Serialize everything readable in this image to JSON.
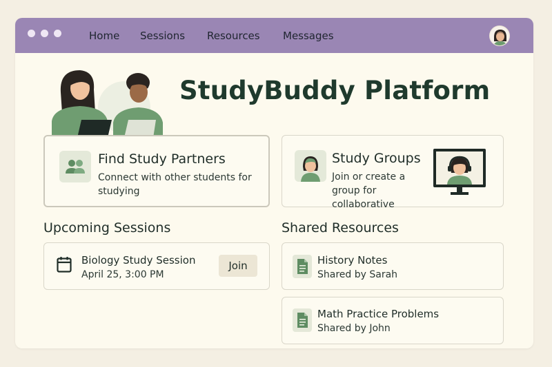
{
  "nav": {
    "items": [
      "Home",
      "Sessions",
      "Resources",
      "Messages"
    ]
  },
  "hero": {
    "title": "StudyBuddy Platform"
  },
  "features": [
    {
      "title": "Find Study Partners",
      "description": "Connect with other students for studying",
      "icon": "people-icon"
    },
    {
      "title": "Study Groups",
      "description": "Join or create a group for collaborative",
      "icon": "student-avatar-icon"
    }
  ],
  "upcoming": {
    "heading": "Upcoming Sessions",
    "sessions": [
      {
        "title": "Biology Study Session",
        "datetime": "April 25, 3:00 PM",
        "action": "Join",
        "icon": "calendar-icon"
      }
    ]
  },
  "resources": {
    "heading": "Shared Resources",
    "items": [
      {
        "title": "History Notes",
        "shared_by": "Shared by Sarah",
        "icon": "document-icon"
      },
      {
        "title": "Math Practice Problems",
        "shared_by": "Shared by John",
        "icon": "document-icon"
      }
    ]
  },
  "colors": {
    "topbar": "#9a86b4",
    "accent_green": "#6b9a6e",
    "title_green": "#1f3a2d",
    "page_bg": "#f4efe3",
    "window_bg": "#fdfaee"
  }
}
